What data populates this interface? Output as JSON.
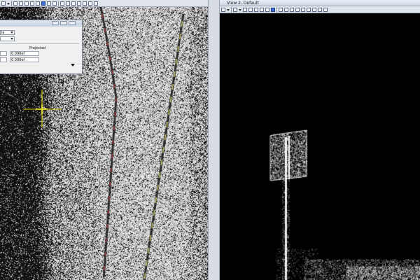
{
  "left_view": {
    "toolbar_icons": [
      "view-attributes-icon",
      "dropdown-icon",
      "fit-view-icon",
      "zoom-in-icon",
      "zoom-out-icon",
      "window-area-icon",
      "pan-icon",
      "rotate-icon",
      "view-previous-icon",
      "view-next-icon",
      "update-view-icon",
      "display-style-icon",
      "clip-icon",
      "copy-view-icon",
      "camera-icon",
      "ruler-icon",
      "settings-icon"
    ],
    "dialog": {
      "combo1": "le",
      "combo2": "",
      "projected_label": "Projected",
      "field1": "0.000ef",
      "field2": "0.000ef"
    }
  },
  "right_view": {
    "title": "View 2, Default",
    "toolbar_icons": [
      "view-attributes-icon",
      "dropdown-icon",
      "display-mode-icon",
      "dropdown-icon",
      "fit-view-icon",
      "zoom-in-icon",
      "zoom-out-icon",
      "window-area-icon",
      "pan-icon",
      "rotate-icon",
      "view-previous-icon",
      "view-next-icon",
      "update-view-icon",
      "display-style-icon",
      "clip-icon",
      "copy-view-icon",
      "camera-icon",
      "ruler-icon",
      "settings-icon"
    ]
  },
  "colors": {
    "road_marking_red": "#d23a3a",
    "road_marking_yellow": "#e3e36b",
    "cursor_yellow": "#e6e01c",
    "points": "#ffffff"
  }
}
